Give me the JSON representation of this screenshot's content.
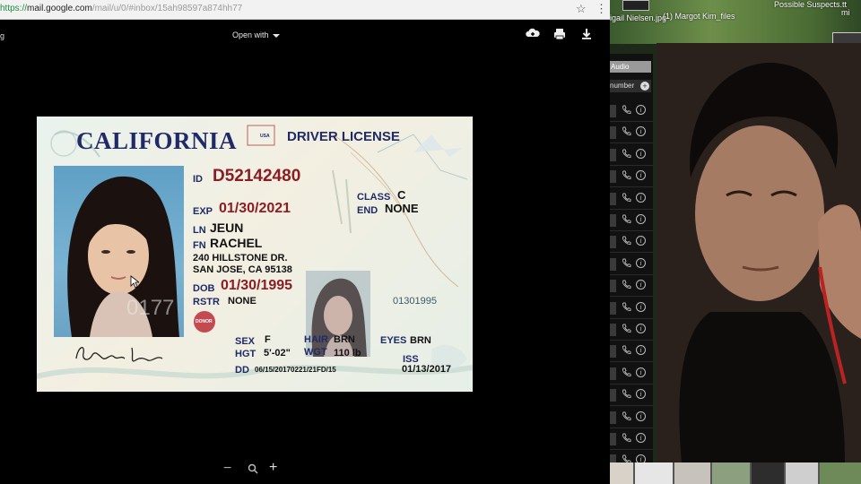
{
  "browser": {
    "url_scheme": "https://",
    "url_host": "mail.google.com",
    "url_path": "/mail/u/0/#inbox/15ah98597a874hh77"
  },
  "viewer": {
    "filename": "g",
    "open_with_label": "Open with",
    "zoom_out_label": "−",
    "zoom_in_label": "+"
  },
  "license": {
    "state": "CALIFORNIA",
    "usa_tag": "USA",
    "doc_type": "DRIVER LICENSE",
    "id_label": "ID",
    "id_number": "D52142480",
    "class_label": "CLASS",
    "class_value": "C",
    "exp_label": "EXP",
    "exp_value": "01/30/2021",
    "end_label": "END",
    "end_value": "NONE",
    "ln_label": "LN",
    "last_name": "JEUN",
    "fn_label": "FN",
    "first_name": "RACHEL",
    "address_line1": "240 HILLSTONE DR.",
    "address_line2": "SAN JOSE, CA 95138",
    "dob_label": "DOB",
    "dob_value": "01/30/1995",
    "rstr_label": "RSTR",
    "rstr_value": "NONE",
    "donor_label": "DONOR",
    "sex_label": "SEX",
    "sex_value": "F",
    "hgt_label": "HGT",
    "hgt_value": "5'-02\"",
    "hair_label": "HAIR",
    "hair_value": "BRN",
    "wgt_label": "WGT",
    "wgt_value": "110 lb",
    "eyes_label": "EYES",
    "eyes_value": "BRN",
    "dd_label": "DD",
    "dd_value": "06/15/20170221/21FD/15",
    "iss_label": "ISS",
    "iss_value": "01/13/2017",
    "sequence_number": "01301995",
    "photo_overlay_number": "0177"
  },
  "right_panel": {
    "files": [
      "igail Nielsen.jpg",
      "(1) Margot Kim_files",
      "Possible Suspects.tt",
      "mi"
    ],
    "audio_label": "Audio",
    "number_label": "number",
    "contact_rows": 18
  },
  "colors": {
    "license_blue": "#1f2a66",
    "license_red": "#8b1d24",
    "url_green": "#1e8e3e"
  }
}
